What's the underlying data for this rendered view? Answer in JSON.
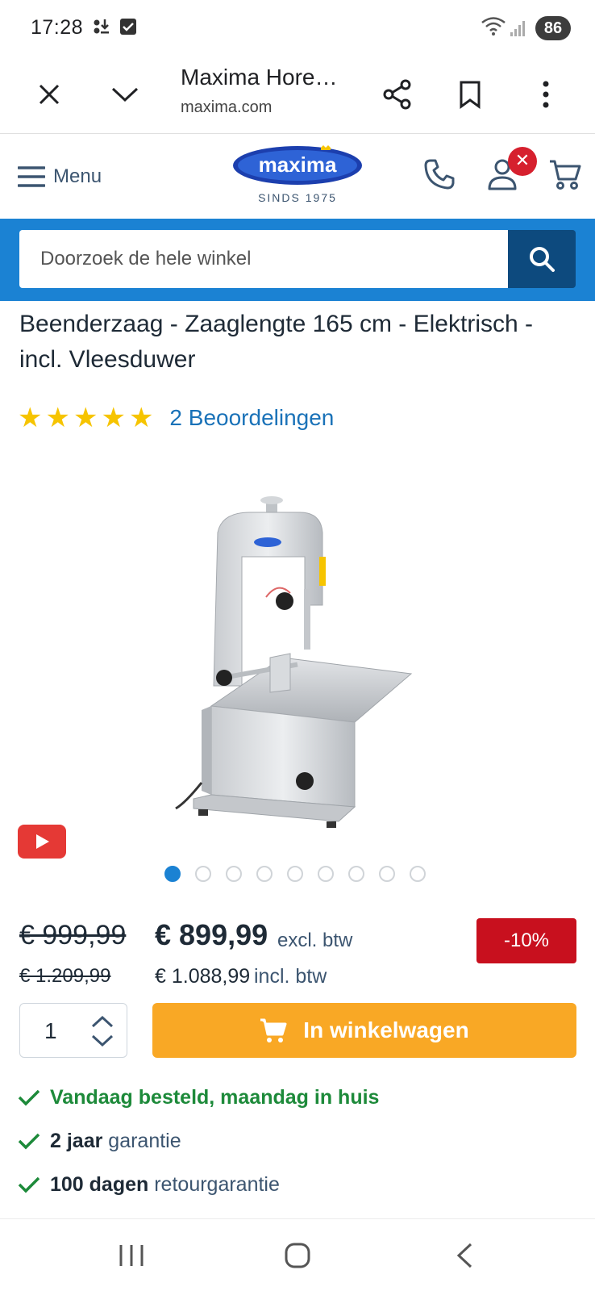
{
  "status_bar": {
    "time": "17:28",
    "battery": "86"
  },
  "browser": {
    "title": "Maxima Hore…",
    "url": "maxima.com"
  },
  "header": {
    "menu_label": "Menu",
    "logo_text": "maxima",
    "logo_tagline": "SINDS 1975",
    "account_badge": "✕"
  },
  "search": {
    "placeholder": "Doorzoek de hele winkel"
  },
  "product": {
    "title": "Beenderzaag - Zaaglengte 165 cm - Elektrisch - incl. Vleesduwer",
    "rating": 5,
    "reviews_label": "2 Beoordelingen",
    "gallery": {
      "slides": 9,
      "active": 0
    }
  },
  "price": {
    "old_excl": "€ 999,99",
    "new_excl": "€ 899,99",
    "excl_label": "excl. btw",
    "old_incl": "€ 1.209,99",
    "new_incl": "€ 1.088,99",
    "incl_label": "incl. btw",
    "discount": "-10%"
  },
  "cart": {
    "quantity": "1",
    "button_label": "In winkelwagen"
  },
  "usps": {
    "delivery": "Vandaag besteld, maandag in huis",
    "warranty_strong": "2 jaar",
    "warranty_text": "garantie",
    "return_strong": "100 dagen",
    "return_text": "retourgarantie"
  },
  "colors": {
    "brand_blue": "#1b82d3",
    "dark_blue": "#0d4a7e",
    "cart_orange": "#f9a825",
    "discount_red": "#c8101e",
    "star_yellow": "#f6c400",
    "check_green": "#1d8a3a"
  }
}
